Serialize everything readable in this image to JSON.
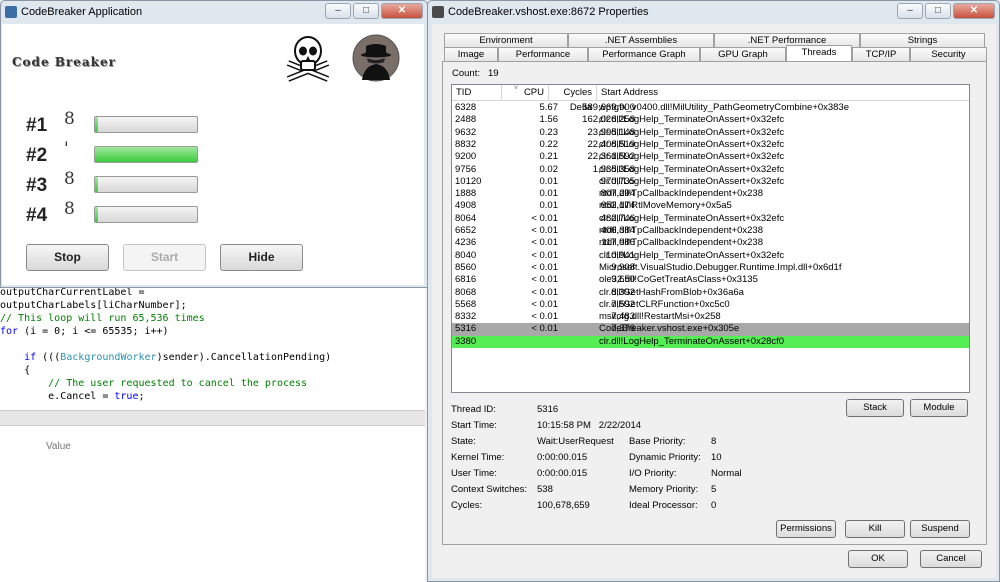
{
  "code_editor": {
    "lines": [
      {
        "parts": [
          {
            "t": "outputCharCurrentLabel =",
            "c": ""
          }
        ]
      },
      {
        "parts": [
          {
            "t": "outputCharLabels[liCharNumber];",
            "c": ""
          }
        ]
      },
      {
        "parts": [
          {
            "t": "// This loop will run 65,536 times",
            "c": "cm"
          }
        ]
      },
      {
        "parts": [
          {
            "t": "for",
            "c": "kw"
          },
          {
            "t": " (i = 0; i <= 65535; i++)",
            "c": ""
          }
        ]
      },
      {
        "parts": [
          {
            "t": "",
            "c": ""
          }
        ]
      },
      {
        "parts": [
          {
            "t": "    ",
            "c": ""
          },
          {
            "t": "if",
            "c": "kw"
          },
          {
            "t": " (((",
            "c": ""
          },
          {
            "t": "BackgroundWorker",
            "c": "ty"
          },
          {
            "t": ")sender).CancellationPending)",
            "c": ""
          }
        ]
      },
      {
        "parts": [
          {
            "t": "    {",
            "c": ""
          }
        ]
      },
      {
        "parts": [
          {
            "t": "        // The user requested to cancel the process",
            "c": "cm"
          }
        ]
      },
      {
        "parts": [
          {
            "t": "        e.Cancel = ",
            "c": ""
          },
          {
            "t": "true",
            "c": "kw"
          },
          {
            "t": ";",
            "c": ""
          }
        ]
      }
    ],
    "value_label": "Value"
  },
  "codebreaker": {
    "window_title": "CodeBreaker Application",
    "app_title": "Code Breaker",
    "rows": [
      {
        "label": "#1",
        "char": "8",
        "progress": 0.03
      },
      {
        "label": "#2",
        "char": "'",
        "progress": 1.0
      },
      {
        "label": "#3",
        "char": "8",
        "progress": 0.03
      },
      {
        "label": "#4",
        "char": "8",
        "progress": 0.03
      }
    ],
    "buttons": {
      "stop": "Stop",
      "start": "Start",
      "hide": "Hide"
    }
  },
  "properties": {
    "window_title": "CodeBreaker.vshost.exe:8672 Properties",
    "tabs_row1": [
      "Environment",
      ".NET Assemblies",
      ".NET Performance",
      "Strings"
    ],
    "tabs_row2": [
      "Image",
      "Performance",
      "Performance Graph",
      "GPU Graph",
      "Threads",
      "TCP/IP",
      "Security"
    ],
    "selected_tab": "Threads",
    "count_label": "Count:",
    "count_value": "19",
    "columns": [
      "TID",
      "CPU",
      "Cycles Delta",
      "Start Address"
    ],
    "threads": [
      {
        "tid": "6328",
        "cpu": "5.67",
        "cycles": "589,669,900",
        "addr": "wpfgfx_v0400.dll!MilUtility_PathGeometryCombine+0x383e"
      },
      {
        "tid": "2488",
        "cpu": "1.56",
        "cycles": "162,026,258",
        "addr": "clr.dll!LogHelp_TerminateOnAssert+0x32efc"
      },
      {
        "tid": "9632",
        "cpu": "0.23",
        "cycles": "23,995,148",
        "addr": "clr.dll!LogHelp_TerminateOnAssert+0x32efc"
      },
      {
        "tid": "8832",
        "cpu": "0.22",
        "cycles": "22,408,519",
        "addr": "clr.dll!LogHelp_TerminateOnAssert+0x32efc"
      },
      {
        "tid": "9200",
        "cpu": "0.21",
        "cycles": "22,361,592",
        "addr": "clr.dll!LogHelp_TerminateOnAssert+0x32efc"
      },
      {
        "tid": "9756",
        "cpu": "0.02",
        "cycles": "1,935,358",
        "addr": "clr.dll!LogHelp_TerminateOnAssert+0x32efc"
      },
      {
        "tid": "10120",
        "cpu": "0.01",
        "cycles": "970,735",
        "addr": "clr.dll!LogHelp_TerminateOnAssert+0x32efc"
      },
      {
        "tid": "1888",
        "cpu": "0.01",
        "cycles": "807,294",
        "addr": "ntdll.dll!TpCallbackIndependent+0x238"
      },
      {
        "tid": "4908",
        "cpu": "0.01",
        "cycles": "652,174",
        "addr": "ntdll.dll!RtlMoveMemory+0x5a5"
      },
      {
        "tid": "8064",
        "cpu": "< 0.01",
        "cycles": "482,746",
        "addr": "clr.dll!LogHelp_TerminateOnAssert+0x32efc"
      },
      {
        "tid": "6652",
        "cpu": "< 0.01",
        "cycles": "406,384",
        "addr": "ntdll.dll!TpCallbackIndependent+0x238"
      },
      {
        "tid": "4236",
        "cpu": "< 0.01",
        "cycles": "117,986",
        "addr": "ntdll.dll!TpCallbackIndependent+0x238"
      },
      {
        "tid": "8040",
        "cpu": "< 0.01",
        "cycles": "10,941",
        "addr": "clr.dll!LogHelp_TerminateOnAssert+0x32efc"
      },
      {
        "tid": "8560",
        "cpu": "< 0.01",
        "cycles": "9,908",
        "addr": "Microsoft.VisualStudio.Debugger.Runtime.Impl.dll+0x6d1f"
      },
      {
        "tid": "6816",
        "cpu": "< 0.01",
        "cycles": "9,650",
        "addr": "ole32.dll!CoGetTreatAsClass+0x3135"
      },
      {
        "tid": "8068",
        "cpu": "< 0.01",
        "cycles": "8,392",
        "addr": "clr.dll!GetHashFromBlob+0x36a6a"
      },
      {
        "tid": "5568",
        "cpu": "< 0.01",
        "cycles": "7,592",
        "addr": "clr.dll!GetCLRFunction+0xc5c0"
      },
      {
        "tid": "8332",
        "cpu": "< 0.01",
        "cycles": "7,483",
        "addr": "msitcfg.dll!RestartMsi+0x258"
      },
      {
        "tid": "5316",
        "cpu": "< 0.01",
        "cycles": "7,376",
        "addr": "CodeBreaker.vshost.exe+0x305e"
      },
      {
        "tid": "3380",
        "cpu": "",
        "cycles": "",
        "addr": "clr.dll!LogHelp_TerminateOnAssert+0x28cf0"
      }
    ],
    "selected_tid": "5316",
    "new_tid": "3380",
    "stack_button": "Stack",
    "module_button": "Module",
    "info": {
      "thread_id_label": "Thread ID:",
      "thread_id": "5316",
      "start_time_label": "Start Time:",
      "start_time": "10:15:58 PM   2/22/2014",
      "state_label": "State:",
      "state": "Wait:UserRequest",
      "base_priority_label": "Base Priority:",
      "base_priority": "8",
      "kernel_time_label": "Kernel Time:",
      "kernel_time": "0:00:00.015",
      "dynamic_priority_label": "Dynamic Priority:",
      "dynamic_priority": "10",
      "user_time_label": "User Time:",
      "user_time": "0:00:00.015",
      "io_priority_label": "I/O Priority:",
      "io_priority": "Normal",
      "context_switches_label": "Context Switches:",
      "context_switches": "538",
      "memory_priority_label": "Memory Priority:",
      "memory_priority": "5",
      "cycles_label": "Cycles:",
      "cycles": "100,678,659",
      "ideal_processor_label": "Ideal Processor:",
      "ideal_processor": "0"
    },
    "buttons": {
      "permissions": "Permissions",
      "kill": "Kill",
      "suspend": "Suspend",
      "ok": "OK",
      "cancel": "Cancel"
    }
  },
  "colors": {
    "progress_green": "#3ccc3c",
    "selected_row": "#a8a8a8",
    "new_thread_row": "#55ee55"
  }
}
